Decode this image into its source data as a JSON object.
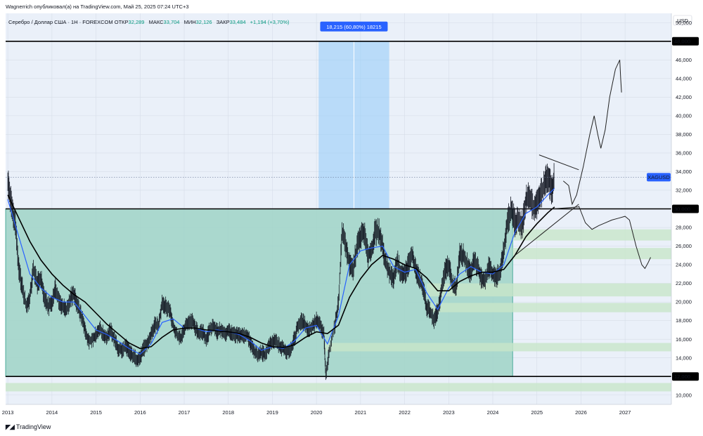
{
  "header": {
    "published_by": "Wagnerrich опубликовал(а) на TradingView.com, Май 25, 2025 07:24 UTC+3"
  },
  "legend": {
    "symbol": "Серебро / Доллар США · 1Н · FOREXCOM",
    "open_label": "ОТКР",
    "open_value": "32,289",
    "high_label": "МАКС",
    "high_value": "33,704",
    "low_label": "МИН",
    "low_value": "32,126",
    "close_label": "ЗАКР",
    "close_value": "33,484",
    "change": "+1,194 (+3,70%)"
  },
  "footer": {
    "logo_text": "TradingView"
  },
  "colors": {
    "background": "#eaf0f9",
    "candle": "#131722",
    "ma_fast": "#2962ff",
    "ma_slow": "#000000",
    "zone_teal": "#9fd3c7",
    "zone_light_green": "#c8e6c9",
    "measure_blue": "#90caf9",
    "badge_blue": "#2962ff",
    "price_label_blue": "#2962ff"
  },
  "chart_data": {
    "type": "candlestick",
    "currency_label": "USD",
    "price_label": "XAGUSD",
    "x_labels": [
      "2013",
      "2014",
      "2015",
      "2016",
      "2017",
      "2018",
      "2019",
      "2020",
      "2021",
      "2022",
      "2023",
      "2024",
      "2025",
      "2026",
      "2027"
    ],
    "y_ticks": [
      "10,000",
      "12,000",
      "14,000",
      "16,000",
      "18,000",
      "20,000",
      "22,000",
      "24,000",
      "26,000",
      "28,000",
      "30,000",
      "32,000",
      "34,000",
      "36,000",
      "38,000",
      "40,000",
      "42,000",
      "44,000",
      "46,000",
      "48,000",
      "50,000"
    ],
    "ylim": [
      9,
      51
    ],
    "xlim": [
      2012.95,
      2028.05
    ],
    "horizontal_levels": [
      {
        "value": 48,
        "label": "48,000"
      },
      {
        "value": 30,
        "label": "30,000"
      },
      {
        "value": 12,
        "label": "12,000"
      }
    ],
    "measure_tool": {
      "label": "18,215 (60,80%) 18215",
      "x_start": 2020.05,
      "x_end": 2021.65,
      "y_low": 30,
      "y_high": 48
    },
    "range_zone": {
      "x_start": 2012.95,
      "x_end": 2024.45,
      "y_low": 12,
      "y_high": 30
    },
    "support_zones": [
      {
        "x_start": 2024.45,
        "x_end": 2028.05,
        "y_low": 26.6,
        "y_high": 27.8
      },
      {
        "x_start": 2024.45,
        "x_end": 2028.05,
        "y_low": 24.6,
        "y_high": 25.8
      },
      {
        "x_start": 2022.5,
        "x_end": 2028.05,
        "y_low": 20.6,
        "y_high": 22.0
      },
      {
        "x_start": 2022.5,
        "x_end": 2028.05,
        "y_low": 18.9,
        "y_high": 19.9
      },
      {
        "x_start": 2020.2,
        "x_end": 2028.05,
        "y_low": 14.7,
        "y_high": 15.6
      },
      {
        "x_start": 2012.95,
        "x_end": 2028.05,
        "y_low": 10.4,
        "y_high": 11.3
      }
    ],
    "price_path": [
      [
        2013.0,
        33.0
      ],
      [
        2013.08,
        30.5
      ],
      [
        2013.17,
        28.5
      ],
      [
        2013.25,
        23.5
      ],
      [
        2013.33,
        21.5
      ],
      [
        2013.42,
        19.5
      ],
      [
        2013.5,
        20.5
      ],
      [
        2013.58,
        23.5
      ],
      [
        2013.67,
        22.0
      ],
      [
        2013.75,
        22.5
      ],
      [
        2013.83,
        20.5
      ],
      [
        2013.92,
        19.5
      ],
      [
        2014.0,
        20.0
      ],
      [
        2014.08,
        21.5
      ],
      [
        2014.17,
        20.0
      ],
      [
        2014.25,
        19.5
      ],
      [
        2014.33,
        19.0
      ],
      [
        2014.42,
        20.5
      ],
      [
        2014.5,
        20.8
      ],
      [
        2014.58,
        19.5
      ],
      [
        2014.67,
        18.5
      ],
      [
        2014.75,
        17.0
      ],
      [
        2014.83,
        15.8
      ],
      [
        2014.92,
        16.0
      ],
      [
        2015.0,
        16.5
      ],
      [
        2015.08,
        17.2
      ],
      [
        2015.17,
        16.5
      ],
      [
        2015.25,
        16.2
      ],
      [
        2015.33,
        17.0
      ],
      [
        2015.42,
        16.0
      ],
      [
        2015.5,
        15.0
      ],
      [
        2015.58,
        14.8
      ],
      [
        2015.67,
        15.2
      ],
      [
        2015.75,
        14.8
      ],
      [
        2015.83,
        14.2
      ],
      [
        2015.92,
        13.9
      ],
      [
        2016.0,
        14.0
      ],
      [
        2016.08,
        15.0
      ],
      [
        2016.17,
        15.5
      ],
      [
        2016.25,
        16.5
      ],
      [
        2016.33,
        17.5
      ],
      [
        2016.42,
        17.5
      ],
      [
        2016.5,
        20.0
      ],
      [
        2016.58,
        19.5
      ],
      [
        2016.67,
        19.2
      ],
      [
        2016.75,
        17.5
      ],
      [
        2016.83,
        16.5
      ],
      [
        2016.92,
        16.0
      ],
      [
        2017.0,
        17.0
      ],
      [
        2017.08,
        17.8
      ],
      [
        2017.17,
        18.0
      ],
      [
        2017.25,
        17.2
      ],
      [
        2017.33,
        16.6
      ],
      [
        2017.42,
        16.8
      ],
      [
        2017.5,
        16.0
      ],
      [
        2017.58,
        17.0
      ],
      [
        2017.67,
        17.5
      ],
      [
        2017.75,
        16.8
      ],
      [
        2017.83,
        17.0
      ],
      [
        2017.92,
        16.5
      ],
      [
        2018.0,
        17.0
      ],
      [
        2018.08,
        16.6
      ],
      [
        2018.17,
        16.4
      ],
      [
        2018.25,
        16.5
      ],
      [
        2018.33,
        16.4
      ],
      [
        2018.42,
        16.5
      ],
      [
        2018.5,
        15.6
      ],
      [
        2018.58,
        14.8
      ],
      [
        2018.67,
        14.2
      ],
      [
        2018.75,
        14.6
      ],
      [
        2018.83,
        14.3
      ],
      [
        2018.92,
        15.2
      ],
      [
        2019.0,
        15.6
      ],
      [
        2019.08,
        15.8
      ],
      [
        2019.17,
        15.2
      ],
      [
        2019.25,
        15.0
      ],
      [
        2019.33,
        14.6
      ],
      [
        2019.42,
        15.0
      ],
      [
        2019.5,
        16.0
      ],
      [
        2019.58,
        17.5
      ],
      [
        2019.67,
        18.0
      ],
      [
        2019.75,
        17.5
      ],
      [
        2019.83,
        17.0
      ],
      [
        2019.92,
        17.5
      ],
      [
        2020.0,
        18.0
      ],
      [
        2020.08,
        17.5
      ],
      [
        2020.17,
        16.5
      ],
      [
        2020.21,
        12.0
      ],
      [
        2020.3,
        15.0
      ],
      [
        2020.42,
        17.5
      ],
      [
        2020.5,
        20.0
      ],
      [
        2020.58,
        27.5
      ],
      [
        2020.67,
        26.0
      ],
      [
        2020.75,
        24.0
      ],
      [
        2020.83,
        23.5
      ],
      [
        2020.92,
        26.0
      ],
      [
        2021.0,
        27.0
      ],
      [
        2021.08,
        27.5
      ],
      [
        2021.17,
        25.0
      ],
      [
        2021.25,
        25.5
      ],
      [
        2021.33,
        27.5
      ],
      [
        2021.42,
        27.5
      ],
      [
        2021.5,
        26.0
      ],
      [
        2021.58,
        24.0
      ],
      [
        2021.67,
        23.0
      ],
      [
        2021.75,
        22.5
      ],
      [
        2021.83,
        24.5
      ],
      [
        2021.92,
        23.0
      ],
      [
        2022.0,
        23.0
      ],
      [
        2022.08,
        24.0
      ],
      [
        2022.17,
        25.0
      ],
      [
        2022.25,
        23.5
      ],
      [
        2022.33,
        22.5
      ],
      [
        2022.42,
        21.5
      ],
      [
        2022.5,
        19.5
      ],
      [
        2022.58,
        19.0
      ],
      [
        2022.67,
        18.0
      ],
      [
        2022.75,
        19.0
      ],
      [
        2022.83,
        21.0
      ],
      [
        2022.92,
        23.5
      ],
      [
        2023.0,
        24.0
      ],
      [
        2023.08,
        22.0
      ],
      [
        2023.17,
        21.5
      ],
      [
        2023.25,
        25.0
      ],
      [
        2023.33,
        25.0
      ],
      [
        2023.42,
        24.0
      ],
      [
        2023.5,
        23.0
      ],
      [
        2023.58,
        24.5
      ],
      [
        2023.67,
        23.5
      ],
      [
        2023.75,
        22.5
      ],
      [
        2023.83,
        22.5
      ],
      [
        2023.92,
        24.0
      ],
      [
        2024.0,
        23.0
      ],
      [
        2024.08,
        22.5
      ],
      [
        2024.17,
        23.5
      ],
      [
        2024.25,
        25.5
      ],
      [
        2024.33,
        28.5
      ],
      [
        2024.42,
        30.0
      ],
      [
        2024.5,
        28.5
      ],
      [
        2024.58,
        29.0
      ],
      [
        2024.67,
        28.0
      ],
      [
        2024.75,
        31.0
      ],
      [
        2024.83,
        31.5
      ],
      [
        2024.92,
        30.0
      ],
      [
        2025.0,
        30.5
      ],
      [
        2025.08,
        31.5
      ],
      [
        2025.17,
        32.5
      ],
      [
        2025.25,
        33.5
      ],
      [
        2025.33,
        32.0
      ],
      [
        2025.4,
        33.4
      ]
    ],
    "ma_fast": [
      [
        2013.0,
        31.0
      ],
      [
        2013.25,
        27.0
      ],
      [
        2013.5,
        23.0
      ],
      [
        2013.75,
        21.5
      ],
      [
        2014.0,
        20.5
      ],
      [
        2014.25,
        20.0
      ],
      [
        2014.5,
        20.0
      ],
      [
        2014.75,
        18.5
      ],
      [
        2015.0,
        17.0
      ],
      [
        2015.25,
        16.5
      ],
      [
        2015.5,
        15.8
      ],
      [
        2015.75,
        15.0
      ],
      [
        2016.0,
        14.4
      ],
      [
        2016.25,
        15.5
      ],
      [
        2016.5,
        17.8
      ],
      [
        2016.75,
        18.2
      ],
      [
        2017.0,
        17.2
      ],
      [
        2017.25,
        17.2
      ],
      [
        2017.5,
        16.8
      ],
      [
        2017.75,
        17.0
      ],
      [
        2018.0,
        16.8
      ],
      [
        2018.25,
        16.5
      ],
      [
        2018.5,
        15.8
      ],
      [
        2018.75,
        14.8
      ],
      [
        2019.0,
        15.2
      ],
      [
        2019.25,
        15.0
      ],
      [
        2019.5,
        15.8
      ],
      [
        2019.75,
        17.2
      ],
      [
        2020.0,
        17.5
      ],
      [
        2020.25,
        15.5
      ],
      [
        2020.5,
        18.5
      ],
      [
        2020.75,
        24.0
      ],
      [
        2021.0,
        25.5
      ],
      [
        2021.25,
        25.8
      ],
      [
        2021.5,
        26.0
      ],
      [
        2021.75,
        23.8
      ],
      [
        2022.0,
        23.2
      ],
      [
        2022.25,
        23.5
      ],
      [
        2022.5,
        21.0
      ],
      [
        2022.75,
        19.2
      ],
      [
        2023.0,
        21.5
      ],
      [
        2023.25,
        23.0
      ],
      [
        2023.5,
        23.8
      ],
      [
        2023.75,
        23.2
      ],
      [
        2024.0,
        23.0
      ],
      [
        2024.25,
        24.0
      ],
      [
        2024.5,
        27.5
      ],
      [
        2024.75,
        29.5
      ],
      [
        2025.0,
        30.2
      ],
      [
        2025.25,
        31.5
      ],
      [
        2025.4,
        32.2
      ]
    ],
    "ma_slow": [
      [
        2013.0,
        31.5
      ],
      [
        2013.25,
        29.0
      ],
      [
        2013.5,
        26.5
      ],
      [
        2013.75,
        24.5
      ],
      [
        2014.0,
        23.0
      ],
      [
        2014.25,
        21.8
      ],
      [
        2014.5,
        20.8
      ],
      [
        2014.75,
        20.0
      ],
      [
        2015.0,
        18.8
      ],
      [
        2015.25,
        17.6
      ],
      [
        2015.5,
        16.6
      ],
      [
        2015.75,
        15.6
      ],
      [
        2016.0,
        15.0
      ],
      [
        2016.25,
        15.2
      ],
      [
        2016.5,
        16.2
      ],
      [
        2016.75,
        17.0
      ],
      [
        2017.0,
        17.2
      ],
      [
        2017.25,
        17.2
      ],
      [
        2017.5,
        17.0
      ],
      [
        2017.75,
        16.9
      ],
      [
        2018.0,
        16.8
      ],
      [
        2018.25,
        16.6
      ],
      [
        2018.5,
        16.2
      ],
      [
        2018.75,
        15.6
      ],
      [
        2019.0,
        15.2
      ],
      [
        2019.25,
        15.1
      ],
      [
        2019.5,
        15.4
      ],
      [
        2019.75,
        16.2
      ],
      [
        2020.0,
        16.8
      ],
      [
        2020.25,
        16.6
      ],
      [
        2020.5,
        17.5
      ],
      [
        2020.75,
        20.5
      ],
      [
        2021.0,
        22.5
      ],
      [
        2021.25,
        24.0
      ],
      [
        2021.5,
        25.0
      ],
      [
        2021.75,
        24.6
      ],
      [
        2022.0,
        24.0
      ],
      [
        2022.25,
        23.6
      ],
      [
        2022.5,
        22.6
      ],
      [
        2022.75,
        21.2
      ],
      [
        2023.0,
        21.2
      ],
      [
        2023.25,
        22.2
      ],
      [
        2023.5,
        22.8
      ],
      [
        2023.75,
        23.2
      ],
      [
        2024.0,
        23.2
      ],
      [
        2024.25,
        23.5
      ],
      [
        2024.5,
        25.0
      ],
      [
        2024.75,
        27.0
      ],
      [
        2025.0,
        28.4
      ],
      [
        2025.25,
        29.6
      ],
      [
        2025.4,
        30.2
      ]
    ],
    "trendlines": [
      {
        "points": [
          [
            2025.05,
            35.8
          ],
          [
            2025.95,
            34.2
          ]
        ]
      },
      {
        "points": [
          [
            2024.5,
            25.0
          ],
          [
            2025.95,
            30.5
          ]
        ]
      },
      {
        "points": [
          [
            2025.35,
            30.0
          ],
          [
            2025.95,
            30.2
          ]
        ]
      }
    ],
    "forecast_up": [
      [
        2025.6,
        33.0
      ],
      [
        2025.72,
        32.5
      ],
      [
        2025.8,
        30.5
      ],
      [
        2025.9,
        31.5
      ],
      [
        2026.05,
        34.5
      ],
      [
        2026.2,
        38.0
      ],
      [
        2026.3,
        40.0
      ],
      [
        2026.38,
        38.0
      ],
      [
        2026.45,
        36.5
      ],
      [
        2026.55,
        38.5
      ],
      [
        2026.65,
        42.0
      ],
      [
        2026.78,
        45.0
      ],
      [
        2026.88,
        46.0
      ],
      [
        2026.9,
        44.0
      ],
      [
        2026.92,
        42.5
      ]
    ],
    "forecast_down": [
      [
        2025.95,
        30.3
      ],
      [
        2026.1,
        28.5
      ],
      [
        2026.25,
        27.8
      ],
      [
        2026.4,
        28.2
      ],
      [
        2026.55,
        28.5
      ],
      [
        2026.7,
        28.8
      ],
      [
        2026.85,
        29.0
      ],
      [
        2027.0,
        29.2
      ],
      [
        2027.1,
        28.8
      ],
      [
        2027.25,
        26.0
      ],
      [
        2027.38,
        24.0
      ],
      [
        2027.45,
        23.6
      ],
      [
        2027.52,
        24.2
      ],
      [
        2027.58,
        24.8
      ]
    ]
  }
}
